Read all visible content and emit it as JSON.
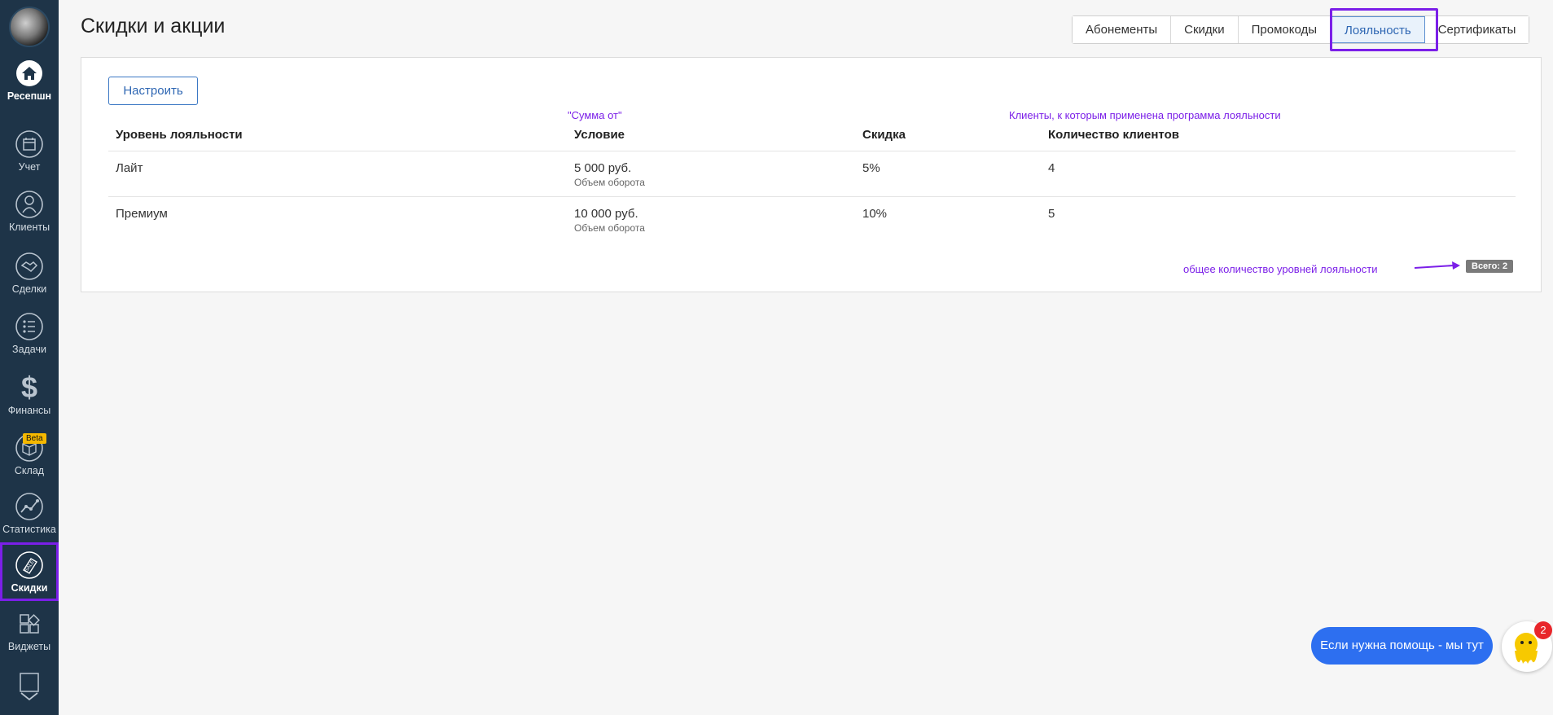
{
  "sidebar": {
    "items": [
      {
        "label": "Ресепшн",
        "icon": "home-icon"
      },
      {
        "label": "Учет",
        "icon": "calendar-icon"
      },
      {
        "label": "Клиенты",
        "icon": "client-icon"
      },
      {
        "label": "Сделки",
        "icon": "handshake-icon"
      },
      {
        "label": "Задачи",
        "icon": "tasks-icon"
      },
      {
        "label": "Финансы",
        "icon": "dollar-icon"
      },
      {
        "label": "Склад",
        "icon": "box-icon",
        "badge": "Beta"
      },
      {
        "label": "Статистика",
        "icon": "chart-icon"
      },
      {
        "label": "Скидки",
        "icon": "sale-tag-icon"
      },
      {
        "label": "Виджеты",
        "icon": "widgets-icon"
      }
    ]
  },
  "header": {
    "title": "Скидки и акции",
    "tabs": [
      {
        "label": "Абонементы"
      },
      {
        "label": "Скидки"
      },
      {
        "label": "Промокоды"
      },
      {
        "label": "Лояльность"
      },
      {
        "label": "Сертификаты"
      }
    ]
  },
  "panel": {
    "setup_button": "Настроить",
    "annotations": {
      "condition_note": "\"Сумма от\"",
      "clients_note": "Клиенты, к которым применена программа лояльности",
      "total_note": "общее количество уровней лояльности"
    },
    "columns": [
      "Уровень лояльности",
      "Условие",
      "Скидка",
      "Количество клиентов"
    ],
    "rows": [
      {
        "level": "Лайт",
        "condition": "5 000 руб.",
        "condition_sub": "Объем оборота",
        "discount": "5%",
        "clients": "4"
      },
      {
        "level": "Премиум",
        "condition": "10 000 руб.",
        "condition_sub": "Объем оборота",
        "discount": "10%",
        "clients": "5"
      }
    ],
    "total": "Всего: 2"
  },
  "help": {
    "label": "Если нужна помощь - мы тут",
    "notification_count": "2"
  },
  "colors": {
    "sidebar_bg": "#1e3448",
    "accent": "#2f67b3",
    "annotation": "#7b1fe8",
    "help_button": "#2d6ff0",
    "badge_red": "#e8262b"
  }
}
